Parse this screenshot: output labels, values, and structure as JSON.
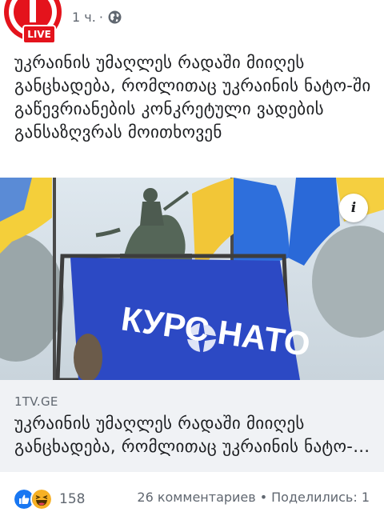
{
  "header": {
    "time": "1 ч.",
    "separator": "·",
    "privacy_icon": "globe-icon",
    "live_badge": "LIVE",
    "brand_color": "#e4131c"
  },
  "post": {
    "text": "უკრაინის უმაღლეს რადაში მიიღეს განცხადება, რომლითაც უკრაინის ნატო-ში გაწევრიანების კონკრეტული ვადების განსაზღვრას მოითხოვენ"
  },
  "link_preview": {
    "image_text": "КУРС НАТО",
    "info_label": "i",
    "domain": "1TV.GE",
    "title": "უკრაინის უმაღლეს რადაში მიიღეს განცხადება, რომლითაც უკრაინის ნატო-ში გაწევრიანების კონკრეტული ვადების განსაზღვრას მოითხოვენ"
  },
  "footer": {
    "reaction_icons": [
      "like-icon",
      "haha-icon"
    ],
    "reaction_count": "158",
    "comments": "26 комментариев",
    "dot": "•",
    "shares": "Поделились: 1",
    "like_color": "#1877f2",
    "haha_color": "#f7b125"
  }
}
